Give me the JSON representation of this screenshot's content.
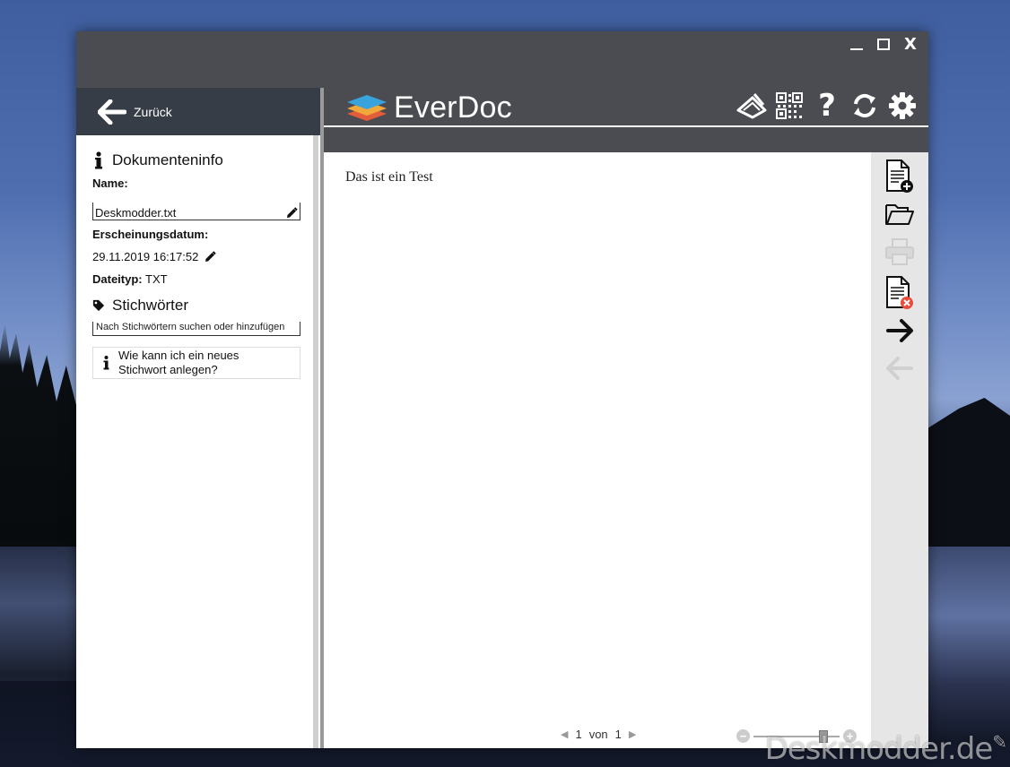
{
  "window": {
    "controls": [
      "minimize",
      "maximize",
      "close"
    ],
    "close_label": "X"
  },
  "back": {
    "label": "Zurück"
  },
  "app": {
    "name": "EverDoc"
  },
  "toolbar": {
    "icons": [
      "scanner-icon",
      "qr-code-icon",
      "help-icon",
      "sync-icon",
      "settings-icon"
    ],
    "help_glyph": "?"
  },
  "info": {
    "title": "Dokumenteninfo",
    "name_label": "Name:",
    "name_value": "Deskmodder.txt",
    "date_label": "Erscheinungsdatum:",
    "date_value": "29.11.2019 16:17:52",
    "type_label": "Dateityp:",
    "type_value": "TXT"
  },
  "tags": {
    "title": "Stichwörter",
    "placeholder": "Nach Stichwörtern suchen oder hinzufügen",
    "help_text": "Wie kann ich ein neues Stichwort anlegen?"
  },
  "document": {
    "content": "Das ist ein Test"
  },
  "side_tools": [
    {
      "icon": "new-document-icon",
      "enabled": true
    },
    {
      "icon": "open-folder-icon",
      "enabled": true
    },
    {
      "icon": "print-icon",
      "enabled": false
    },
    {
      "icon": "delete-document-icon",
      "enabled": true
    },
    {
      "icon": "next-arrow-icon",
      "enabled": true
    },
    {
      "icon": "previous-arrow-icon",
      "enabled": false
    }
  ],
  "pager": {
    "current": "1",
    "of_label": "von",
    "total": "1"
  },
  "zoom": {
    "minus": "−",
    "plus": "+",
    "level": 0.85
  },
  "watermark": "Deskmodder.de",
  "colors": {
    "titlebar": "#4a4c52",
    "back_bar": "#373d47",
    "side_tools": "#e6e6e6",
    "delete_badge": "#e74c3c"
  }
}
